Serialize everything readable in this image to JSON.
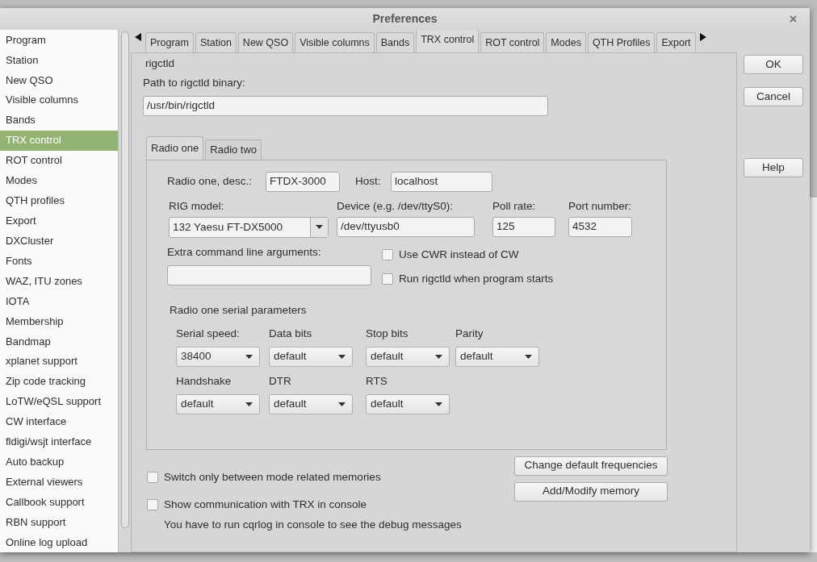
{
  "window": {
    "title": "Preferences"
  },
  "sidebar": {
    "items": [
      {
        "label": "Program",
        "selected": false
      },
      {
        "label": "Station",
        "selected": false
      },
      {
        "label": "New QSO",
        "selected": false
      },
      {
        "label": "Visible columns",
        "selected": false
      },
      {
        "label": "Bands",
        "selected": false
      },
      {
        "label": "TRX control",
        "selected": true
      },
      {
        "label": "ROT control",
        "selected": false
      },
      {
        "label": "Modes",
        "selected": false
      },
      {
        "label": "QTH profiles",
        "selected": false
      },
      {
        "label": "Export",
        "selected": false
      },
      {
        "label": "DXCluster",
        "selected": false
      },
      {
        "label": "Fonts",
        "selected": false
      },
      {
        "label": "WAZ, ITU zones",
        "selected": false
      },
      {
        "label": "IOTA",
        "selected": false
      },
      {
        "label": "Membership",
        "selected": false
      },
      {
        "label": "Bandmap",
        "selected": false
      },
      {
        "label": "xplanet support",
        "selected": false
      },
      {
        "label": "Zip code tracking",
        "selected": false
      },
      {
        "label": "LoTW/eQSL support",
        "selected": false
      },
      {
        "label": "CW interface",
        "selected": false
      },
      {
        "label": "fldigi/wsjt interface",
        "selected": false
      },
      {
        "label": "Auto backup",
        "selected": false
      },
      {
        "label": "External viewers",
        "selected": false
      },
      {
        "label": "Callbook support",
        "selected": false
      },
      {
        "label": "RBN support",
        "selected": false
      },
      {
        "label": "Online log upload",
        "selected": false
      }
    ]
  },
  "tabs": [
    {
      "label": "Program",
      "selected": false
    },
    {
      "label": "Station",
      "selected": false
    },
    {
      "label": "New QSO",
      "selected": false
    },
    {
      "label": "Visible columns",
      "selected": false
    },
    {
      "label": "Bands",
      "selected": false
    },
    {
      "label": "TRX control",
      "selected": true
    },
    {
      "label": "ROT control",
      "selected": false
    },
    {
      "label": "Modes",
      "selected": false
    },
    {
      "label": "QTH Profiles",
      "selected": false
    },
    {
      "label": "Export",
      "selected": false
    }
  ],
  "page": {
    "heading": "rigctld",
    "path_label": "Path to rigctld binary:",
    "path_value": "/usr/bin/rigctld",
    "radio_tabs": [
      {
        "label": "Radio one",
        "selected": true
      },
      {
        "label": "Radio two",
        "selected": false
      }
    ],
    "desc_label": "Radio one, desc.:",
    "desc_value": "FTDX-3000",
    "host_label": "Host:",
    "host_value": "localhost",
    "rig_label": "RIG model:",
    "rig_value": "132 Yaesu FT-DX5000",
    "device_label": "Device (e.g. /dev/ttyS0):",
    "device_value": "/dev/ttyusb0",
    "poll_label": "Poll rate:",
    "poll_value": "125",
    "port_label": "Port number:",
    "port_value": "4532",
    "extra_label": "Extra command line arguments:",
    "options": [
      {
        "label": "Use CWR instead of CW",
        "checked": false
      },
      {
        "label": "Run rigctld when program starts",
        "checked": false
      }
    ],
    "serial_heading": "Radio one serial parameters",
    "serial_rows": [
      [
        {
          "label": "Serial speed:",
          "value": "38400"
        },
        {
          "label": "Data bits",
          "value": "default"
        },
        {
          "label": "Stop bits",
          "value": "default"
        },
        {
          "label": "Parity",
          "value": "default"
        }
      ],
      [
        {
          "label": "Handshake",
          "value": "default"
        },
        {
          "label": "DTR",
          "value": "default"
        },
        {
          "label": "RTS",
          "value": "default"
        }
      ]
    ],
    "bottom_options": [
      {
        "label": "Switch only between mode related memories",
        "checked": false
      },
      {
        "label": "Show communication with TRX in console",
        "checked": false
      }
    ],
    "note": "You have to run cqrlog in console to see the debug messages",
    "side_buttons": [
      "Change default frequencies",
      "Add/Modify memory"
    ]
  },
  "buttons": [
    "OK",
    "Cancel",
    "Help"
  ]
}
